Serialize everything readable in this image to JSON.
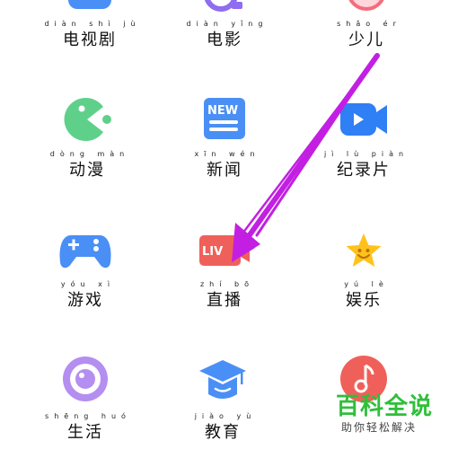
{
  "grid": {
    "items": [
      {
        "key": "tv",
        "pinyin": "diàn shì jù",
        "label": "电视剧",
        "icon": "tv-series-icon"
      },
      {
        "key": "movie",
        "pinyin": "diàn yǐng",
        "label": "电影",
        "icon": "movie-icon"
      },
      {
        "key": "kids",
        "pinyin": "shǎo ér",
        "label": "少儿",
        "icon": "kids-icon"
      },
      {
        "key": "anime",
        "pinyin": "dòng màn",
        "label": "动漫",
        "icon": "anime-icon",
        "color": "#5fd08a"
      },
      {
        "key": "news",
        "pinyin": "xīn wén",
        "label": "新闻",
        "icon": "news-icon",
        "badge": "NEW",
        "color": "#4a8ff5"
      },
      {
        "key": "documentary",
        "pinyin": "jì lù piàn",
        "label": "纪录片",
        "icon": "documentary-icon",
        "color": "#2f7ff5"
      },
      {
        "key": "games",
        "pinyin": "yóu xì",
        "label": "游戏",
        "icon": "gamepad-icon",
        "color": "#4a8ff5"
      },
      {
        "key": "live",
        "pinyin": "zhí bō",
        "label": "直播",
        "icon": "live-icon",
        "badge": "LIV",
        "color": "#f0605a"
      },
      {
        "key": "entertainment",
        "pinyin": "yú lè",
        "label": "娱乐",
        "icon": "star-face-icon",
        "color": "#ffc21a"
      },
      {
        "key": "life",
        "pinyin": "shēng huó",
        "label": "生活",
        "icon": "life-icon",
        "color": "#b48ef0"
      },
      {
        "key": "education",
        "pinyin": "jiào yù",
        "label": "教育",
        "icon": "education-icon",
        "color": "#4a8ff5"
      },
      {
        "key": "music",
        "pinyin": "",
        "label": "",
        "icon": "music-icon",
        "color": "#f0605a"
      }
    ]
  },
  "watermark": {
    "title": "百科全说",
    "subtitle": "助你轻松解决"
  },
  "annotation": {
    "type": "arrow",
    "color": "#c31fe3",
    "icon": "pointer-arrow"
  }
}
